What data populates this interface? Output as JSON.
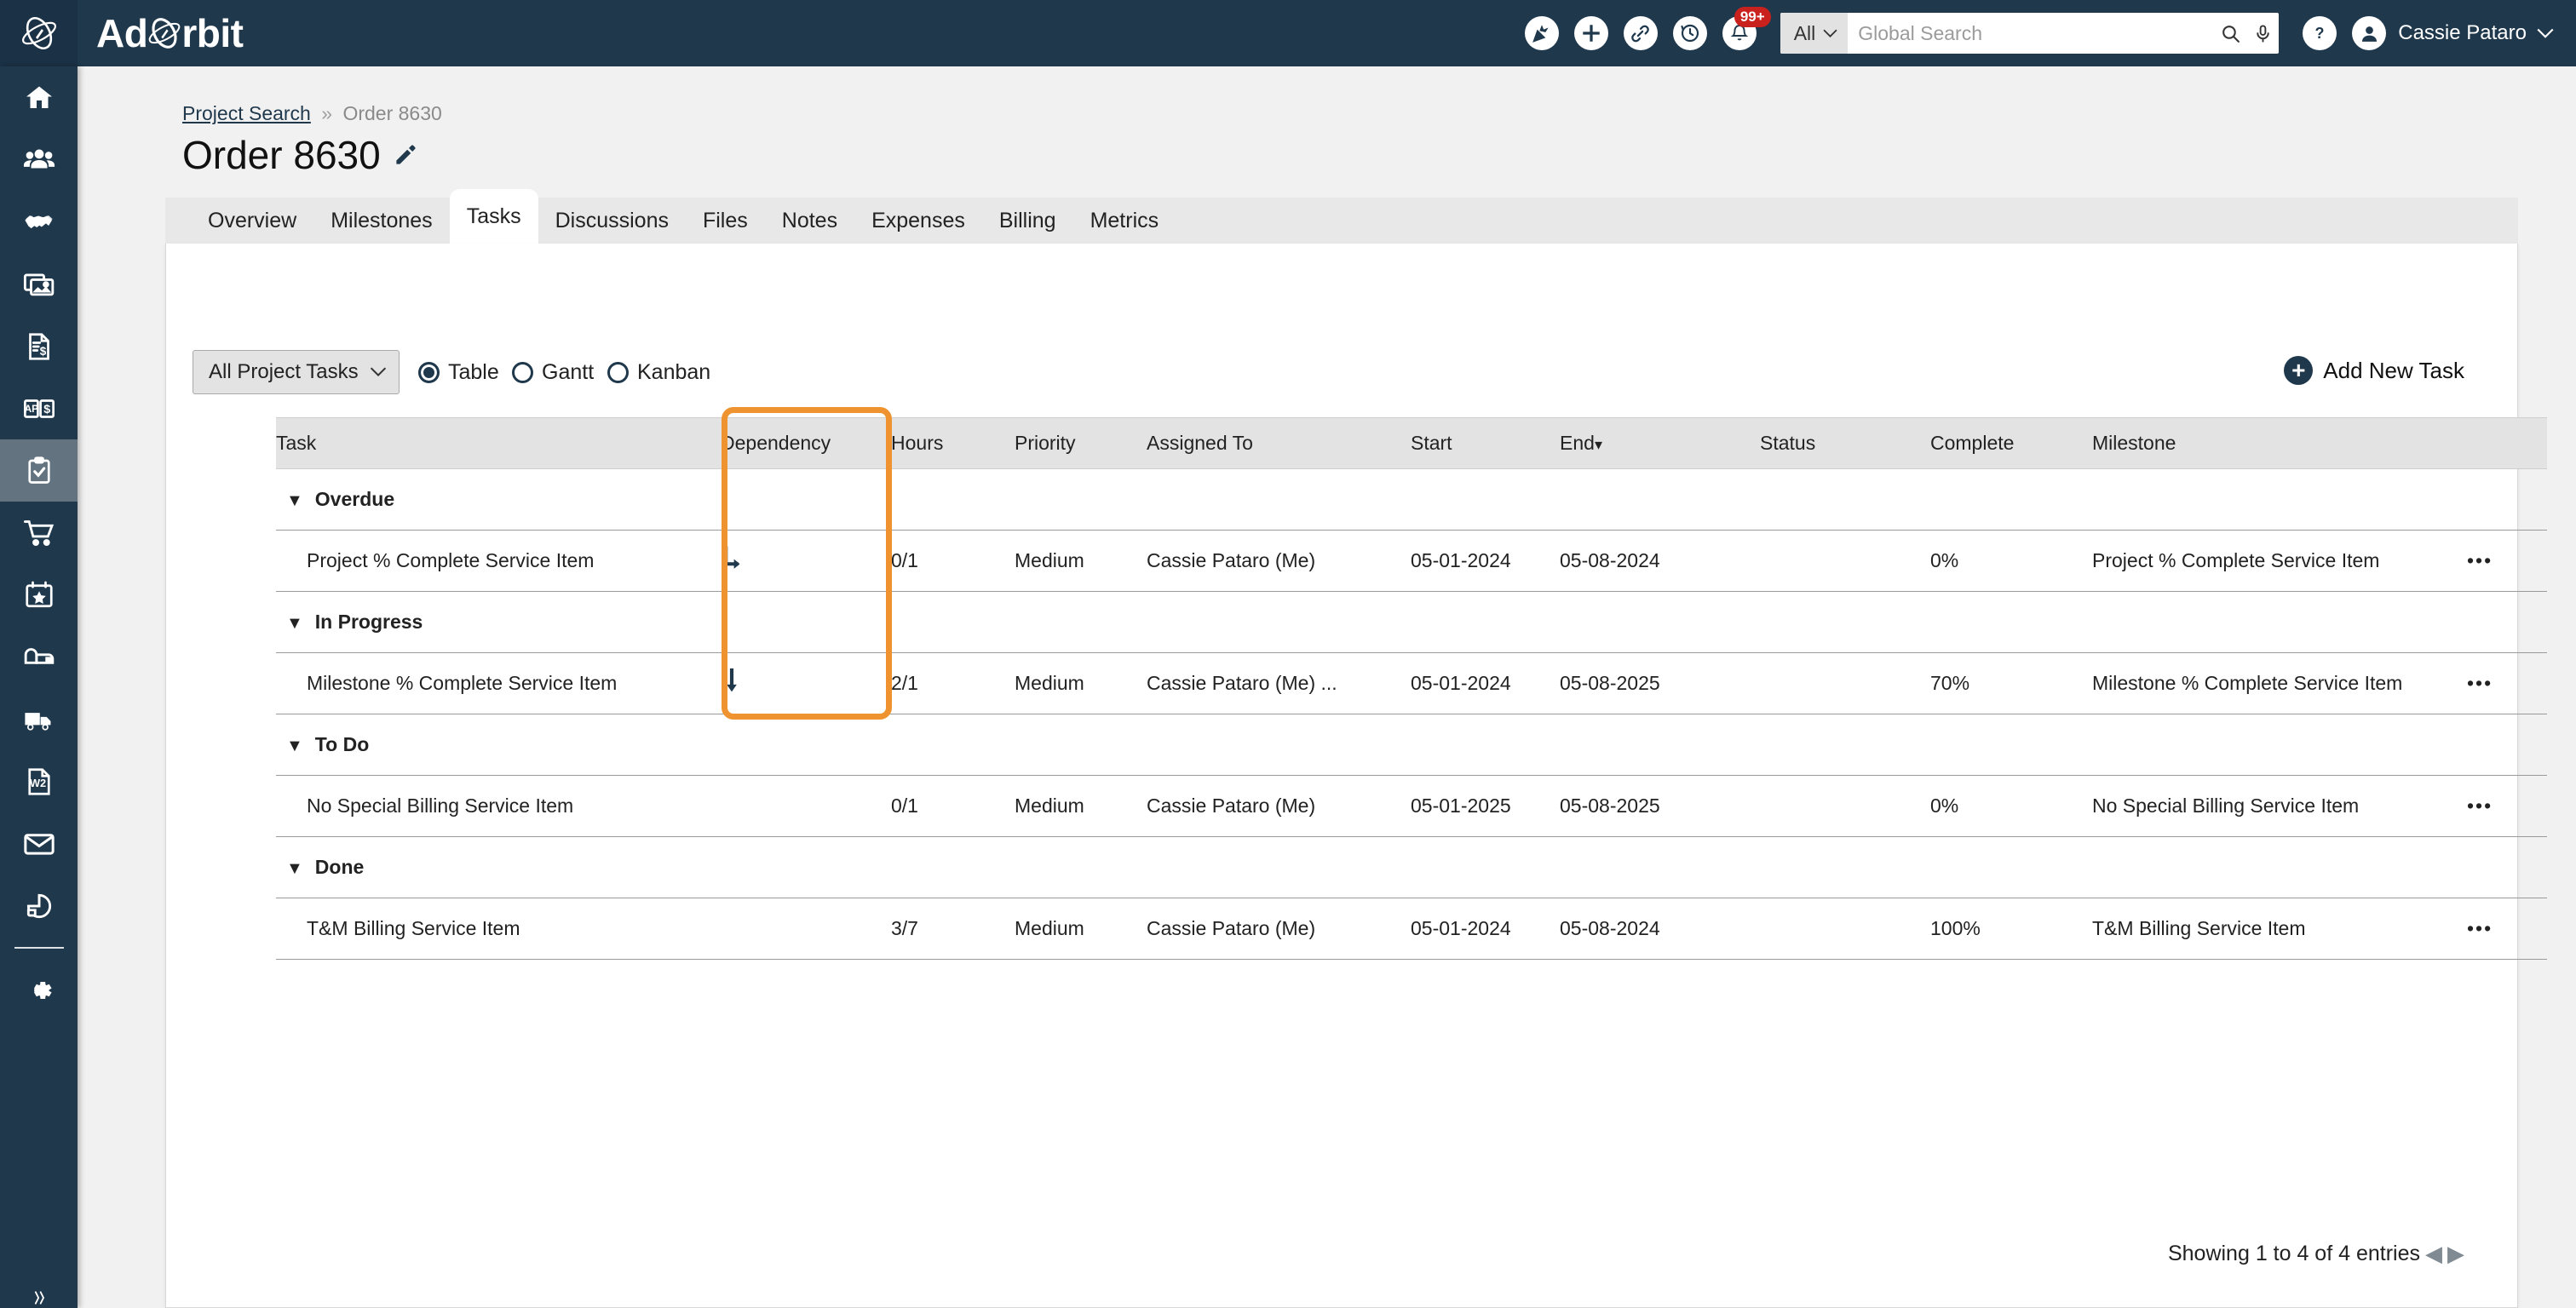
{
  "app": {
    "brand_pre": "Ad",
    "brand_post": "rbit",
    "logo_icon": "planet-orbit-icon"
  },
  "topbar": {
    "icons": [
      {
        "name": "celebration-icon",
        "glyph": "🎉"
      },
      {
        "name": "add-icon",
        "glyph": "+"
      },
      {
        "name": "link-icon",
        "glyph": "🔗"
      },
      {
        "name": "history-icon",
        "glyph": "↺"
      },
      {
        "name": "notifications-bell-icon",
        "glyph": "🔔"
      }
    ],
    "notification_badge": "99+",
    "search_scope": "All",
    "search_placeholder": "Global Search",
    "search_value": "",
    "search_icon": "search-icon",
    "mic_icon": "microphone-icon",
    "help_icon": "question-mark-icon",
    "avatar_icon": "user-avatar-icon",
    "user_name": "Cassie Pataro",
    "user_caret": "⌄"
  },
  "sidebar": {
    "items": [
      {
        "name": "home",
        "icon": "home-icon"
      },
      {
        "name": "contacts",
        "icon": "people-group-icon"
      },
      {
        "name": "deals",
        "icon": "handshake-icon"
      },
      {
        "name": "media",
        "icon": "photos-icon"
      },
      {
        "name": "invoices",
        "icon": "invoice-dollar-icon"
      },
      {
        "name": "accounts-payable",
        "icon": "ap-book-dollar-icon"
      },
      {
        "name": "tasks",
        "icon": "clipboard-check-icon",
        "active": true
      },
      {
        "name": "orders",
        "icon": "shopping-cart-icon"
      },
      {
        "name": "campaigns",
        "icon": "calendar-star-icon"
      },
      {
        "name": "mailbox",
        "icon": "mailbox-icon"
      },
      {
        "name": "shipping",
        "icon": "delivery-truck-icon"
      },
      {
        "name": "w2-forms",
        "icon": "w2-document-icon"
      },
      {
        "name": "email",
        "icon": "envelope-icon"
      },
      {
        "name": "reports",
        "icon": "pie-chart-icon"
      },
      {
        "name": "settings",
        "icon": "gear-icon"
      }
    ],
    "collapse_icon": "double-chevron-icon"
  },
  "breadcrumb": {
    "link": "Project Search",
    "separator": "»",
    "current": "Order 8630"
  },
  "page": {
    "title": "Order 8630",
    "edit_icon": "pencil-icon"
  },
  "tabs": [
    {
      "label": "Overview",
      "active": false
    },
    {
      "label": "Milestones",
      "active": false
    },
    {
      "label": "Tasks",
      "active": true
    },
    {
      "label": "Discussions",
      "active": false
    },
    {
      "label": "Files",
      "active": false
    },
    {
      "label": "Notes",
      "active": false
    },
    {
      "label": "Expenses",
      "active": false
    },
    {
      "label": "Billing",
      "active": false
    },
    {
      "label": "Metrics",
      "active": false
    }
  ],
  "toolbar": {
    "filter_value": "All Project Tasks",
    "filter_caret": "⌄",
    "views": [
      {
        "label": "Table",
        "selected": true
      },
      {
        "label": "Gantt",
        "selected": false
      },
      {
        "label": "Kanban",
        "selected": false
      }
    ],
    "add_task_label": "Add New Task",
    "add_icon": "plus-circle-icon"
  },
  "table": {
    "columns": [
      "Task",
      "Dependency",
      "Hours",
      "Priority",
      "Assigned To",
      "Start",
      "End",
      "Status",
      "Complete",
      "Milestone"
    ],
    "sorted_column": "End",
    "sort_caret": "▾",
    "groups": [
      {
        "label": "Overdue",
        "caret": "▼",
        "rows": [
          {
            "task": "Project % Complete Service Item",
            "dependency_icon": "level-down-arrow-icon",
            "hours": "0/1",
            "priority": "Medium",
            "assigned_to": "Cassie Pataro (Me)",
            "start": "05-01-2024",
            "end": "05-08-2024",
            "status": "",
            "complete": "0%",
            "milestone": "Project % Complete Service Item",
            "actions": "•••"
          }
        ]
      },
      {
        "label": "In Progress",
        "caret": "▼",
        "rows": [
          {
            "task": "Milestone % Complete Service Item",
            "dependency_icon": "down-arrow-icon",
            "hours": "2/1",
            "priority": "Medium",
            "assigned_to": "Cassie Pataro (Me) ...",
            "start": "05-01-2024",
            "end": "05-08-2025",
            "status": "",
            "complete": "70%",
            "milestone": "Milestone % Complete Service Item",
            "actions": "•••"
          }
        ]
      },
      {
        "label": "To Do",
        "caret": "▼",
        "rows": [
          {
            "task": "No Special Billing Service Item",
            "dependency_icon": "",
            "hours": "0/1",
            "priority": "Medium",
            "assigned_to": "Cassie Pataro (Me)",
            "start": "05-01-2025",
            "end": "05-08-2025",
            "status": "",
            "complete": "0%",
            "milestone": "No Special Billing Service Item",
            "actions": "•••"
          }
        ]
      },
      {
        "label": "Done",
        "caret": "▼",
        "rows": [
          {
            "task": "T&M Billing Service Item",
            "dependency_icon": "",
            "hours": "3/7",
            "priority": "Medium",
            "assigned_to": "Cassie Pataro (Me)",
            "start": "05-01-2024",
            "end": "05-08-2024",
            "status": "",
            "complete": "100%",
            "milestone": "T&M Billing Service Item",
            "actions": "•••"
          }
        ]
      }
    ]
  },
  "footer": {
    "showing_text": "Showing 1 to 4 of 4 entries",
    "prev_icon": "◀",
    "next_icon": "▶"
  },
  "highlight": {
    "target_column": "Dependency",
    "color": "#ef9331"
  },
  "colors": {
    "brand_navy": "#1f384c",
    "page_bg": "#f1f1f1",
    "header_row": "#e3e3e3",
    "badge_red": "#c9211e",
    "highlight_orange": "#ef9331"
  }
}
